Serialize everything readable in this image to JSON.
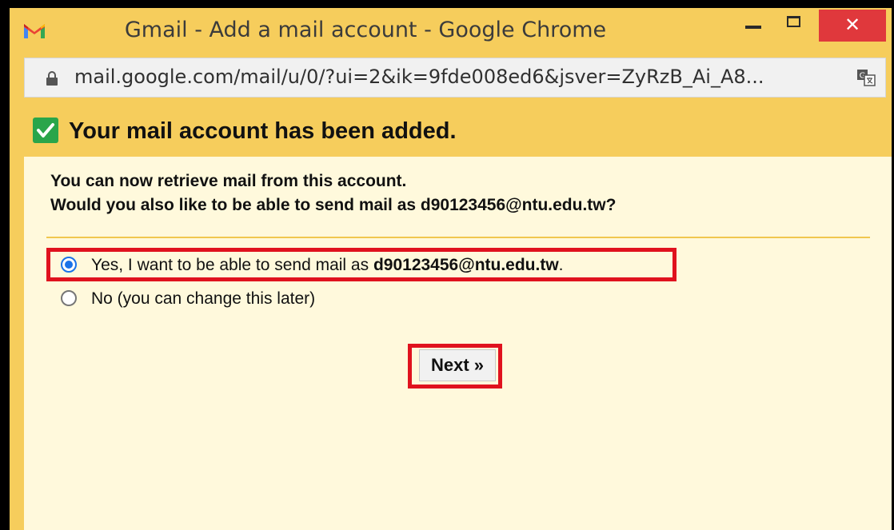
{
  "window": {
    "title": "Gmail - Add a mail account - Google Chrome",
    "close_glyph": "✕",
    "url": "mail.google.com/mail/u/0/?ui=2&ik=9fde008ed6&jsver=ZyRzB_Ai_A8..."
  },
  "dialog": {
    "heading": "Your mail account has been added.",
    "message_line1": "You can now retrieve mail from this account.",
    "message_line2": "Would you also like to be able to send mail as d90123456@ntu.edu.tw?",
    "options": [
      {
        "label_prefix": "Yes, I want to be able to send mail as ",
        "label_bold": "d90123456@ntu.edu.tw",
        "label_suffix": ".",
        "checked": true
      },
      {
        "label_prefix": "No (you can change this later)",
        "label_bold": "",
        "label_suffix": "",
        "checked": false
      }
    ],
    "next_label": "Next »"
  },
  "icons": {
    "logo": "gmail-logo",
    "lock": "lock-icon",
    "translate": "translate-icon",
    "check": "checkbox-checked-icon"
  },
  "colors": {
    "frame": "#f6cd5c",
    "panel": "#fff9dc",
    "highlight": "#e0121e",
    "check": "#2aa54a",
    "radio": "#1a73e8"
  }
}
